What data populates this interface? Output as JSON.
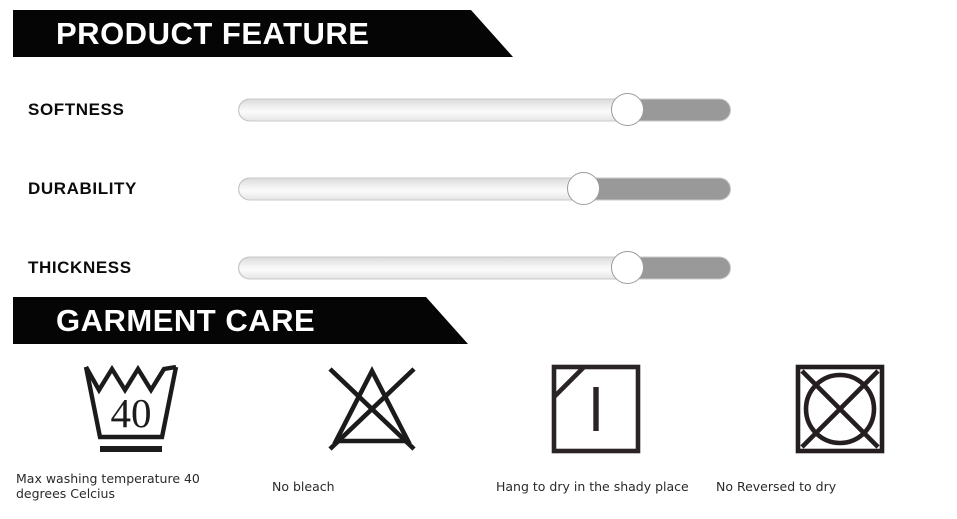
{
  "sections": {
    "product_feature": {
      "banner_title": "PRODUCT FEATURE",
      "features": [
        {
          "label": "SOFTNESS",
          "knob_percent": 79
        },
        {
          "label": "DURABILITY",
          "knob_percent": 70
        },
        {
          "label": "THICKNESS",
          "knob_percent": 79
        }
      ]
    },
    "garment_care": {
      "banner_title": "GARMENT CARE",
      "items": [
        {
          "icon": "wash-tub-40-icon",
          "symbol_text": "40",
          "caption": "Max washing temperature 40 degrees Celcius"
        },
        {
          "icon": "no-bleach-triangle-icon",
          "symbol_text": "",
          "caption": "No bleach"
        },
        {
          "icon": "drip-dry-in-shade-icon",
          "symbol_text": "",
          "caption": "Hang to dry in the shady place"
        },
        {
          "icon": "no-tumble-dry-icon",
          "symbol_text": "",
          "caption": "No Reversed to dry"
        }
      ]
    }
  },
  "colors": {
    "banner_background": "#050505",
    "banner_text": "#ffffff",
    "slider_track_filled": "#999999",
    "slider_track_empty": "#f2f2f2",
    "slider_knob": "#ffffff",
    "page_background": "#ffffff",
    "label_text": "#0b0b0b",
    "caption_text": "#2a2a2a",
    "symbol_stroke": "#1b1b1b"
  }
}
